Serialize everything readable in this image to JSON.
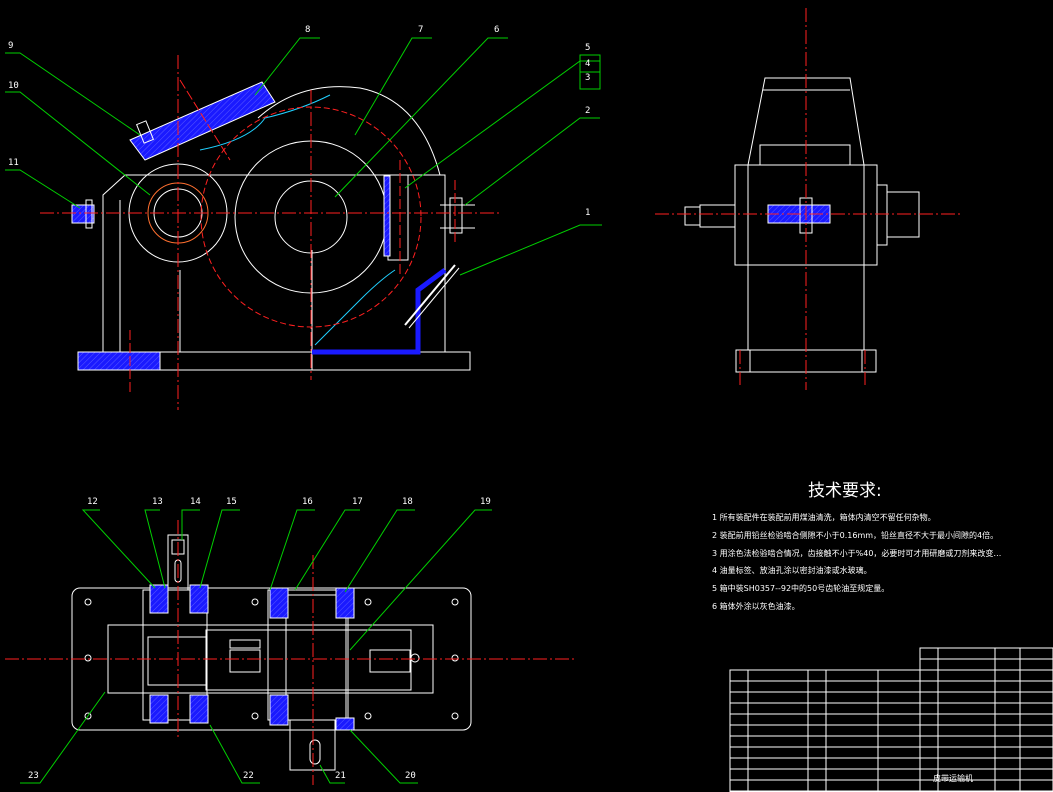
{
  "drawing": {
    "tech_title": "技术要求:",
    "requirements": [
      "1 所有装配件在装配前用煤油清洗，箱体内清空不留任何杂物。",
      "2 装配前用铅丝检验啮合侧隙不小于0.16mm，铅丝直径不大于最小间隙的4倍。",
      "3 用涂色法检验啮合情况，齿接触不小于%40，必要时可才用研磨或刀剂来改变…",
      "4 油量标签、放油孔涂以密封油漆或水玻璃。",
      "5 箱中装SH0357--92中的50号齿轮油至规定量。",
      "6 箱体外涂以灰色油漆。"
    ],
    "title_block_name": "皮带运输机",
    "part_numbers": [
      "1",
      "2",
      "3",
      "4",
      "5",
      "6",
      "7",
      "8",
      "9",
      "10",
      "11",
      "12",
      "13",
      "14",
      "15",
      "16",
      "17",
      "18",
      "19",
      "20",
      "21",
      "22",
      "23"
    ]
  },
  "colors": {
    "outline": "#ffffff",
    "centerline": "#ff2020",
    "leader": "#00d000",
    "hatch": "#1a1aff",
    "seal": "#20d0ff",
    "background": "#000000"
  }
}
